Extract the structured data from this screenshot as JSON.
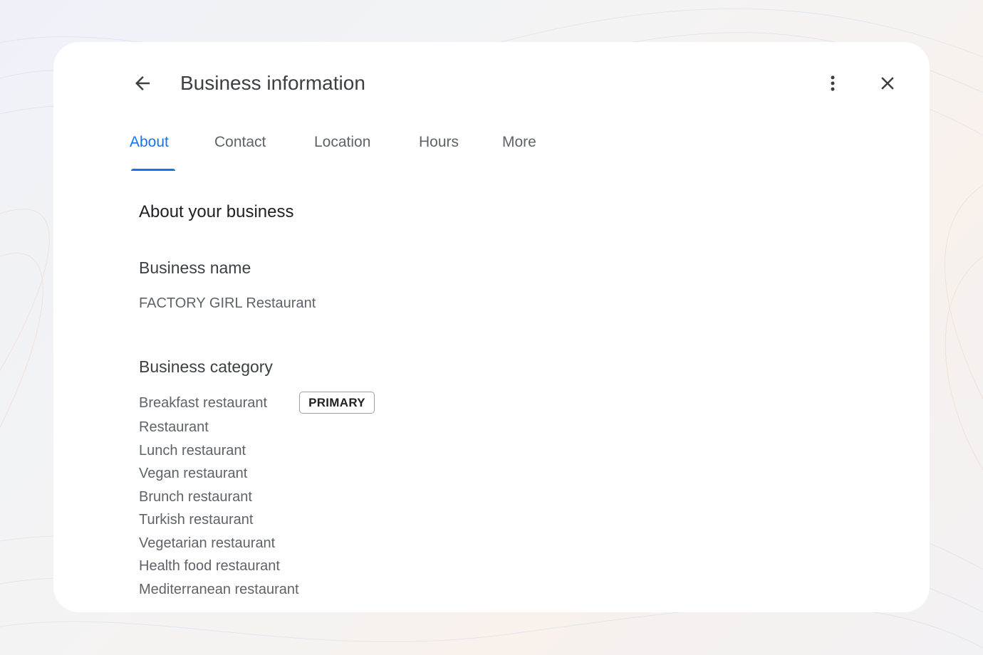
{
  "header": {
    "title": "Business information",
    "back_icon": "arrow-back-icon",
    "more_icon": "more-vertical-icon",
    "close_icon": "close-icon"
  },
  "tabs": [
    {
      "label": "About",
      "active": true
    },
    {
      "label": "Contact",
      "active": false
    },
    {
      "label": "Location",
      "active": false
    },
    {
      "label": "Hours",
      "active": false
    },
    {
      "label": "More",
      "active": false
    }
  ],
  "about": {
    "heading": "About your business",
    "business_name_label": "Business name",
    "business_name_value": "FACTORY GIRL Restaurant",
    "category_label": "Business category",
    "primary_badge": "PRIMARY",
    "categories": [
      "Breakfast restaurant",
      "Restaurant",
      "Lunch restaurant",
      "Vegan restaurant",
      "Brunch restaurant",
      "Turkish restaurant",
      "Vegetarian restaurant",
      "Health food restaurant",
      "Mediterranean restaurant"
    ]
  },
  "colors": {
    "accent": "#1a73e8",
    "text_primary": "#202124",
    "text_secondary": "#5f6368"
  }
}
